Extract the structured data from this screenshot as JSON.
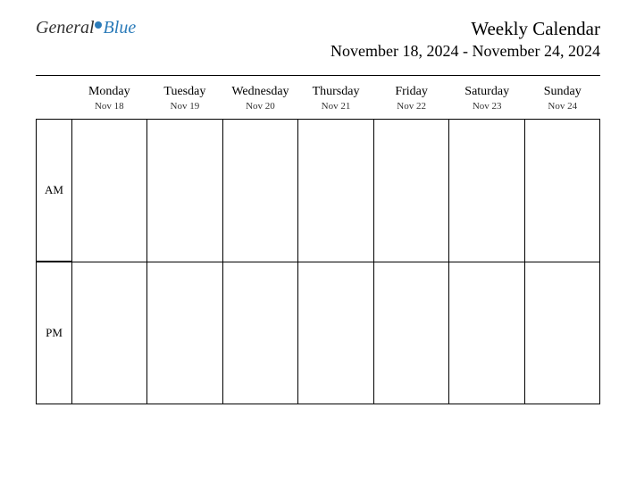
{
  "logo": {
    "part1": "General",
    "part2": "Blue"
  },
  "title": "Weekly Calendar",
  "date_range": "November 18, 2024 - November 24, 2024",
  "days": [
    {
      "name": "Monday",
      "date": "Nov 18"
    },
    {
      "name": "Tuesday",
      "date": "Nov 19"
    },
    {
      "name": "Wednesday",
      "date": "Nov 20"
    },
    {
      "name": "Thursday",
      "date": "Nov 21"
    },
    {
      "name": "Friday",
      "date": "Nov 22"
    },
    {
      "name": "Saturday",
      "date": "Nov 23"
    },
    {
      "name": "Sunday",
      "date": "Nov 24"
    }
  ],
  "periods": [
    "AM",
    "PM"
  ]
}
